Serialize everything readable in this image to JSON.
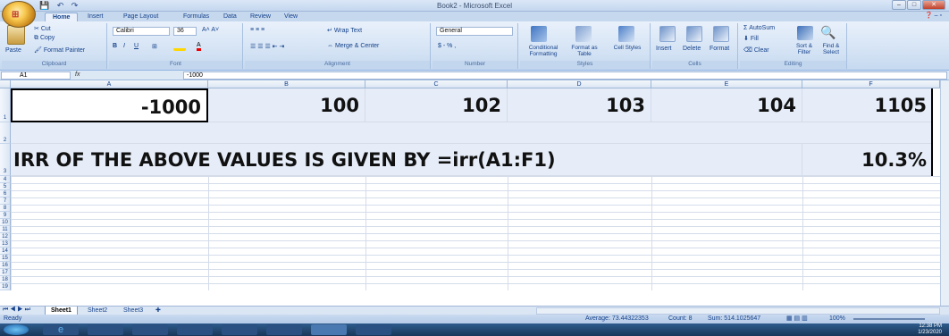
{
  "window": {
    "title": "Book2 - Microsoft Excel"
  },
  "ribbon_tabs": [
    "Home",
    "Insert",
    "Page Layout",
    "Formulas",
    "Data",
    "Review",
    "View"
  ],
  "ribbon": {
    "clipboard": {
      "paste": "Paste",
      "cut": "Cut",
      "copy": "Copy",
      "format_painter": "Format Painter",
      "label": "Clipboard"
    },
    "font": {
      "name": "Calibri",
      "size": "36",
      "label": "Font"
    },
    "alignment": {
      "wrap_text": "Wrap Text",
      "merge_center": "Merge & Center",
      "label": "Alignment"
    },
    "number": {
      "format": "General",
      "symbols": "$ - % ,",
      "label": "Number"
    },
    "styles": {
      "conditional": "Conditional Formatting",
      "format_table": "Format as Table",
      "cell_styles": "Cell Styles",
      "label": "Styles"
    },
    "cells": {
      "insert": "Insert",
      "delete": "Delete",
      "format": "Format",
      "label": "Cells"
    },
    "editing": {
      "autosum": "AutoSum",
      "fill": "Fill",
      "clear": "Clear",
      "sort_filter": "Sort & Filter",
      "find_select": "Find & Select",
      "label": "Editing"
    }
  },
  "formula_bar": {
    "name_box": "A1",
    "fx": "fx",
    "formula": "-1000"
  },
  "columns": [
    "A",
    "B",
    "C",
    "D",
    "E",
    "F"
  ],
  "rows": [
    "1",
    "2",
    "3",
    "4",
    "5",
    "6",
    "7",
    "8",
    "9",
    "10",
    "11",
    "12",
    "13",
    "14",
    "15",
    "16",
    "17",
    "18",
    "19"
  ],
  "cells": {
    "a1": "-1000",
    "b1": "100",
    "c1": "102",
    "d1": "103",
    "e1": "104",
    "f1": "1105",
    "a3": "IRR OF THE ABOVE VALUES IS GIVEN BY  =irr(A1:F1)",
    "f3": "10.3%"
  },
  "sheets": [
    "Sheet1",
    "Sheet2",
    "Sheet3"
  ],
  "status": {
    "ready": "Ready",
    "average": "Average: 73.44322353",
    "count": "Count: 8",
    "sum": "Sum: 514.1025647",
    "zoom": "100%"
  },
  "taskbar": {
    "time": "12:38 PM",
    "date": "1/23/2020"
  },
  "colors": {
    "ribbon_bg": "#d3e2f4",
    "taskbar": "#1f3f66",
    "grid_line": "#d4dcea"
  }
}
